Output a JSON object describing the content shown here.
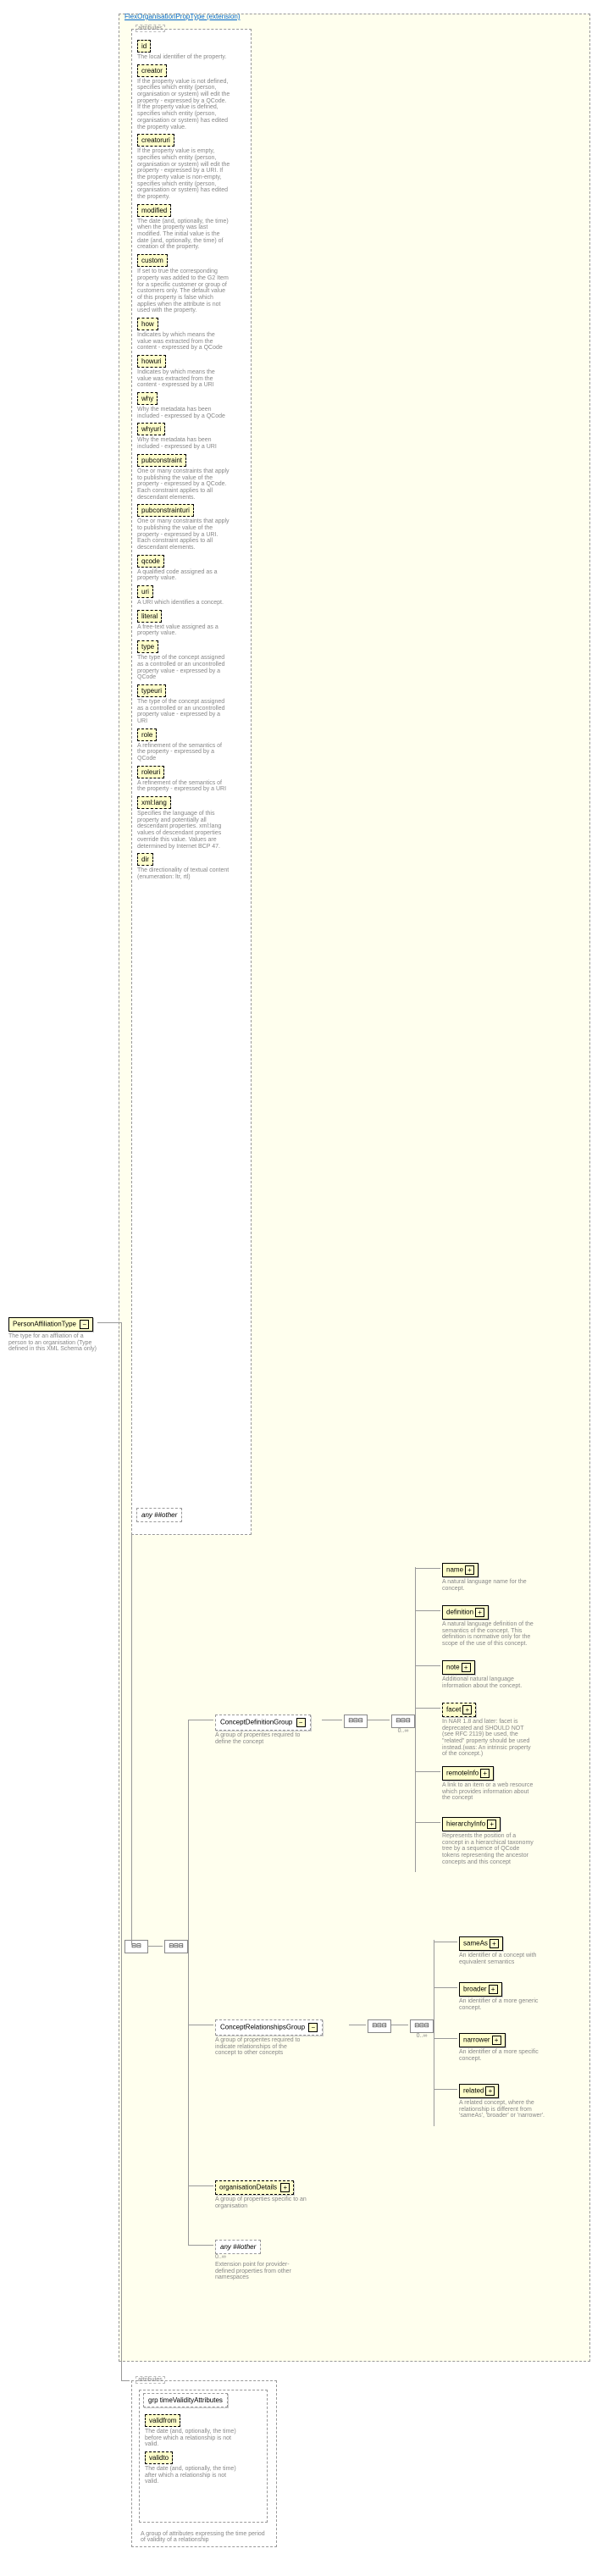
{
  "root": {
    "name": "PersonAffiliationType",
    "desc": "The type for an affliation of a person to an organisation\n(Type defined in this XML Schema only)"
  },
  "extension": {
    "title": "FlexOrganisationPropType (extension)"
  },
  "attributes_header": "attributes",
  "attributes": [
    {
      "name": "id",
      "desc": "The local identifier of the property."
    },
    {
      "name": "creator",
      "desc": "If the property value is not defined, specifies which entity (person, organisation or system) will edit the property - expressed by a QCode. If the property value is defined, specifies which entity (person, organisation or system) has edited the property value."
    },
    {
      "name": "creatoruri",
      "desc": "If the property value is empty, specifies which entity (person, organisation or system) will edit the property - expressed by a URI. If the property value is non-empty, specifies which entity (person, organisation or system) has edited the property."
    },
    {
      "name": "modified",
      "desc": "The date (and, optionally, the time) when the property was last modified. The initial value is the date (and, optionally, the time) of creation of the property."
    },
    {
      "name": "custom",
      "desc": "If set to true the corresponding property was added to the G2 Item for a specific customer or group of customers only. The default value of this property is false which applies when the attribute is not used with the property."
    },
    {
      "name": "how",
      "desc": "Indicates by which means the value was extracted from the content - expressed by a QCode"
    },
    {
      "name": "howuri",
      "desc": "Indicates by which means the value was extracted from the content - expressed by a URI"
    },
    {
      "name": "why",
      "desc": "Why the metadata has been included - expressed by a QCode"
    },
    {
      "name": "whyuri",
      "desc": "Why the metadata has been included - expressed by a URI"
    },
    {
      "name": "pubconstraint",
      "desc": "One or many constraints that apply to publishing the value of the property - expressed by a QCode. Each constraint applies to all descendant elements."
    },
    {
      "name": "pubconstrainturi",
      "desc": "One or many constraints that apply to publishing the value of the property - expressed by a URI. Each constraint applies to all descendant elements."
    },
    {
      "name": "qcode",
      "desc": "A qualified code assigned as a property value."
    },
    {
      "name": "uri",
      "desc": "A URI which identifies a concept."
    },
    {
      "name": "literal",
      "desc": "A free-text value assigned as a property value."
    },
    {
      "name": "type",
      "desc": "The type of the concept assigned as a controlled or an uncontrolled property value - expressed by a QCode"
    },
    {
      "name": "typeuri",
      "desc": "The type of the concept assigned as a controlled or an uncontrolled property value - expressed by a URI"
    },
    {
      "name": "role",
      "desc": "A refinement of the semantics of the property - expressed by a QCode"
    },
    {
      "name": "roleuri",
      "desc": "A refinement of the semantics of the property - expressed by a URI"
    },
    {
      "name": "xml:lang",
      "desc": "Specifies the language of this property and potentially all descendant properties. xml:lang values of descendant properties override this value. Values are determined by Internet BCP 47."
    },
    {
      "name": "dir",
      "desc": "The directionality of textual content (enumeration: ltr, rtl)"
    }
  ],
  "any_other": "any ##other",
  "groups": {
    "conceptDef": {
      "name": "ConceptDefinitionGroup",
      "desc": "A group of properites required to define the concept",
      "children": [
        {
          "name": "name",
          "desc": "A natural language name for the concept."
        },
        {
          "name": "definition",
          "desc": "A natural language definition of the semantics of the concept. This definition is normative only for the scope of the use of this concept."
        },
        {
          "name": "note",
          "desc": "Additional natural language information about the concept."
        },
        {
          "name": "facet",
          "desc": "In NAR 1.8 and later: facet is deprecated and SHOULD NOT (see RFC 2119) be used, the \"related\" property should be used instead.(was: An intrinsic property of the concept.)"
        },
        {
          "name": "remoteInfo",
          "desc": "A link to an item or a web resource which provides information about the concept"
        },
        {
          "name": "hierarchyInfo",
          "desc": "Represents the position of a concept in a hierarchical taxonomy tree by a sequence of QCode tokens representing the ancestor concepts and this concept"
        }
      ]
    },
    "conceptRel": {
      "name": "ConceptRelationshipsGroup",
      "desc": "A group of properites required to indicate relationships of the concept to other concepts",
      "children": [
        {
          "name": "sameAs",
          "desc": "An identifier of a concept with equivalent semantics"
        },
        {
          "name": "broader",
          "desc": "An identifier of a more generic concept."
        },
        {
          "name": "narrower",
          "desc": "An identifier of a more specific concept."
        },
        {
          "name": "related",
          "desc": "A related concept, where the relationship is different from 'sameAs', 'broader' or 'narrower'."
        }
      ]
    },
    "orgDetails": {
      "name": "organisationDetails",
      "desc": "A group of properties specific to an organisation"
    },
    "anyOther2": {
      "name": "any ##other",
      "desc": "Extension point for provider-defined properties from other namespaces",
      "card": "0..∞"
    }
  },
  "validity": {
    "header": "attributes",
    "grp": "grp timeValidityAttributes",
    "validfrom": {
      "name": "validfrom",
      "desc": "The date (and, optionally, the time) before which a relationship is not valid."
    },
    "validto": {
      "name": "validto",
      "desc": "The date (and, optionally, the time) after which a relationship is not valid."
    },
    "footer": "A group of attributes expressing the time period of validity of a relationship"
  }
}
